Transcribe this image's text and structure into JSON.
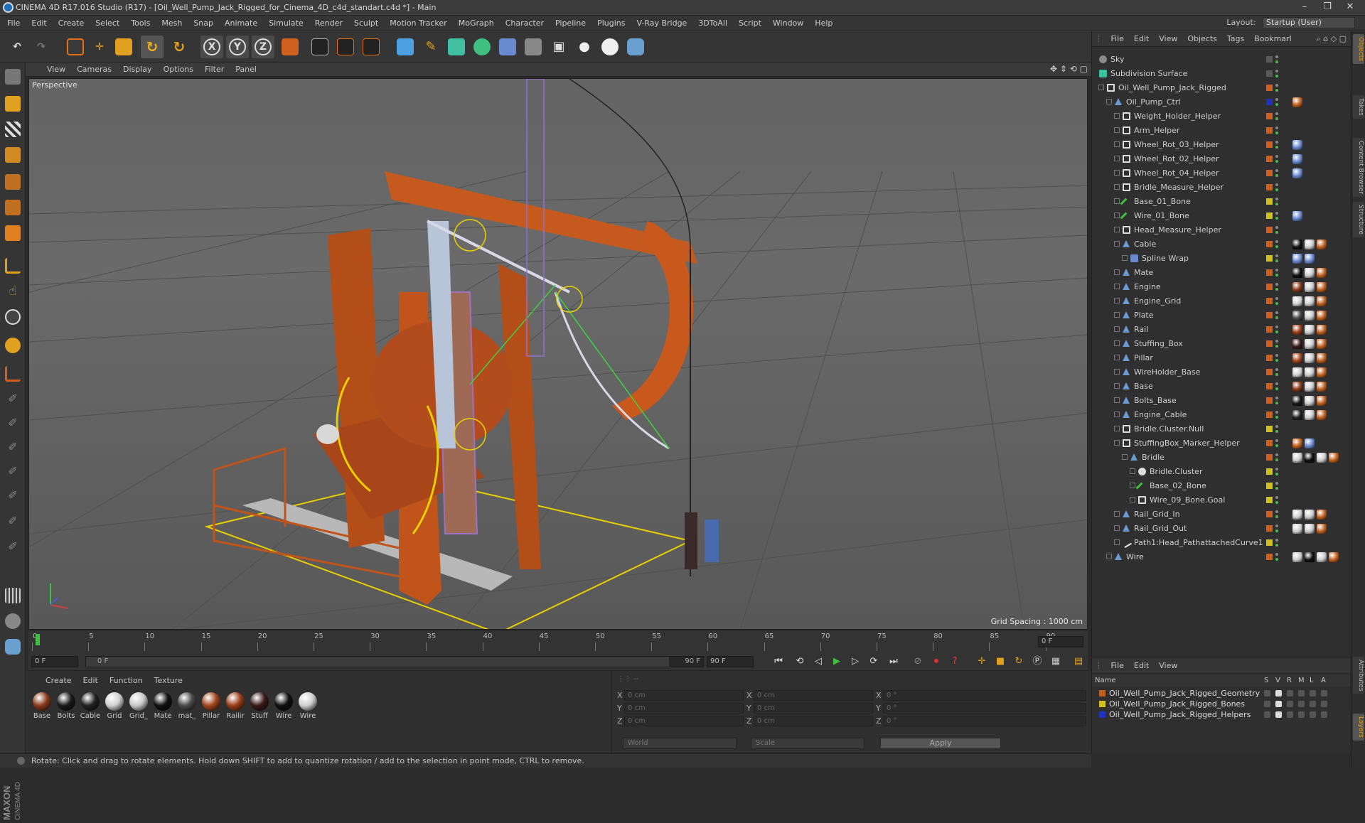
{
  "window": {
    "title": "CINEMA 4D R17.016 Studio (R17) - [Oil_Well_Pump_Jack_Rigged_for_Cinema_4D_c4d_standart.c4d *] - Main",
    "minimize": "–",
    "restore": "❐",
    "close": "✕"
  },
  "menu": [
    "File",
    "Edit",
    "Create",
    "Select",
    "Tools",
    "Mesh",
    "Snap",
    "Animate",
    "Simulate",
    "Render",
    "Sculpt",
    "Motion Tracker",
    "MoGraph",
    "Character",
    "Pipeline",
    "Plugins",
    "V-Ray Bridge",
    "3DToAll",
    "Script",
    "Window",
    "Help"
  ],
  "layout": {
    "label": "Layout:",
    "value": "Startup (User)"
  },
  "toolbar_axes": [
    "X",
    "Y",
    "Z"
  ],
  "viewport": {
    "menu": [
      "View",
      "Cameras",
      "Display",
      "Options",
      "Filter",
      "Panel"
    ],
    "camera_label": "Perspective",
    "grid_spacing": "Grid Spacing : 1000 cm"
  },
  "timeline": {
    "ticks": [
      "0",
      "5",
      "10",
      "15",
      "20",
      "25",
      "30",
      "35",
      "40",
      "45",
      "50",
      "55",
      "60",
      "65",
      "70",
      "75",
      "80",
      "85",
      "90"
    ],
    "end_frame_field": "0 F"
  },
  "playback": {
    "current_frame": "0 F",
    "min_frame": "0 F",
    "max_frame": "90 F",
    "end_frame": "90 F"
  },
  "materials": {
    "menu": [
      "Create",
      "Edit",
      "Function",
      "Texture"
    ],
    "items": [
      {
        "label": "Base",
        "color": "#8a3a1a"
      },
      {
        "label": "Bolts",
        "color": "#1a1a1a"
      },
      {
        "label": "Cable",
        "color": "#222222"
      },
      {
        "label": "Grid",
        "color": "#d0d0d0"
      },
      {
        "label": "Grid_",
        "color": "#c8c8c8"
      },
      {
        "label": "Mate",
        "color": "#101010"
      },
      {
        "label": "mat_",
        "color": "#4a4a4a"
      },
      {
        "label": "Pillar",
        "color": "#a2461e"
      },
      {
        "label": "Railir",
        "color": "#9a3e18"
      },
      {
        "label": "Stuff",
        "color": "#3a1a1a"
      },
      {
        "label": "Wire",
        "color": "#111111"
      },
      {
        "label": "Wire",
        "color": "#cfcfcf"
      }
    ]
  },
  "coords": {
    "rows": [
      {
        "a1": "X",
        "v1": "0 cm",
        "a2": "X",
        "v2": "0 cm",
        "a3": "X",
        "v3": "0 °"
      },
      {
        "a1": "Y",
        "v1": "0 cm",
        "a2": "Y",
        "v2": "0 cm",
        "a3": "Y",
        "v3": "0 °"
      },
      {
        "a1": "Z",
        "v1": "0 cm",
        "a2": "Z",
        "v2": "0 cm",
        "a3": "Z",
        "v3": "0 °"
      }
    ],
    "space": "World",
    "mode": "Scale",
    "apply": "Apply"
  },
  "status": "Rotate: Click and drag to rotate elements. Hold down SHIFT to add to quantize rotation / add to the selection in point mode, CTRL to remove.",
  "objects": {
    "menu": [
      "File",
      "Edit",
      "View",
      "Objects",
      "Tags",
      "Bookmarl"
    ],
    "rows": [
      {
        "name": "Sky",
        "depth": 0,
        "icon": "sky",
        "color": "#5a5a5a",
        "tags": []
      },
      {
        "name": "Subdivision Surface",
        "depth": 0,
        "icon": "subdiv",
        "color": "#5a5a5a",
        "tags": []
      },
      {
        "name": "Oil_Well_Pump_Jack_Rigged",
        "depth": 1,
        "icon": "null",
        "color": "#d06020",
        "tags": []
      },
      {
        "name": "Oil_Pump_Ctrl",
        "depth": 2,
        "icon": "poly",
        "color": "#2030c0",
        "tags": [
          "#c06020"
        ]
      },
      {
        "name": "Weight_Holder_Helper",
        "depth": 3,
        "icon": "null",
        "color": "#d06020",
        "tags": []
      },
      {
        "name": "Arm_Helper",
        "depth": 3,
        "icon": "null",
        "color": "#d06020",
        "tags": []
      },
      {
        "name": "Wheel_Rot_03_Helper",
        "depth": 3,
        "icon": "null",
        "color": "#d06020",
        "tags": [
          "#6a8ad0"
        ]
      },
      {
        "name": "Wheel_Rot_02_Helper",
        "depth": 3,
        "icon": "null",
        "color": "#d06020",
        "tags": [
          "#6a8ad0"
        ]
      },
      {
        "name": "Wheel_Rot_04_Helper",
        "depth": 3,
        "icon": "null",
        "color": "#d06020",
        "tags": [
          "#6a8ad0"
        ]
      },
      {
        "name": "Bridle_Measure_Helper",
        "depth": 3,
        "icon": "null",
        "color": "#d06020",
        "tags": []
      },
      {
        "name": "Base_01_Bone",
        "depth": 3,
        "icon": "bone",
        "color": "#d0c020",
        "tags": []
      },
      {
        "name": "Wire_01_Bone",
        "depth": 3,
        "icon": "bone",
        "color": "#d0c020",
        "tags": [
          "#6a8ad0"
        ]
      },
      {
        "name": "Head_Measure_Helper",
        "depth": 3,
        "icon": "null",
        "color": "#d06020",
        "tags": []
      },
      {
        "name": "Cable",
        "depth": 3,
        "icon": "poly",
        "color": "#d06020",
        "tags": [
          "#111111",
          "#cccccc",
          "#c06020"
        ]
      },
      {
        "name": "Spline Wrap",
        "depth": 4,
        "icon": "deform",
        "color": "#d0c020",
        "tags": [
          "#6a8ad0",
          "#6a8ad0"
        ]
      },
      {
        "name": "Mate",
        "depth": 3,
        "icon": "poly",
        "color": "#d06020",
        "tags": [
          "#111111",
          "#cccccc",
          "#c06020"
        ]
      },
      {
        "name": "Engine",
        "depth": 3,
        "icon": "poly",
        "color": "#d06020",
        "tags": [
          "#8a3a1a",
          "#cccccc",
          "#c06020"
        ]
      },
      {
        "name": "Engine_Grid",
        "depth": 3,
        "icon": "poly",
        "color": "#d06020",
        "tags": [
          "#d0d0d0",
          "#cccccc",
          "#c06020"
        ]
      },
      {
        "name": "Plate",
        "depth": 3,
        "icon": "poly",
        "color": "#d06020",
        "tags": [
          "#4a4a4a",
          "#cccccc",
          "#c06020"
        ]
      },
      {
        "name": "Rail",
        "depth": 3,
        "icon": "poly",
        "color": "#d06020",
        "tags": [
          "#9a3e18",
          "#cccccc",
          "#c06020"
        ]
      },
      {
        "name": "Stuffing_Box",
        "depth": 3,
        "icon": "poly",
        "color": "#d06020",
        "tags": [
          "#3a1a1a",
          "#cccccc",
          "#c06020"
        ]
      },
      {
        "name": "Pillar",
        "depth": 3,
        "icon": "poly",
        "color": "#d06020",
        "tags": [
          "#a2461e",
          "#cccccc",
          "#c06020"
        ]
      },
      {
        "name": "WireHolder_Base",
        "depth": 3,
        "icon": "poly",
        "color": "#d06020",
        "tags": [
          "#cfcfcf",
          "#cccccc",
          "#c06020"
        ]
      },
      {
        "name": "Base",
        "depth": 3,
        "icon": "poly",
        "color": "#d06020",
        "tags": [
          "#8a3a1a",
          "#cccccc",
          "#c06020"
        ]
      },
      {
        "name": "Bolts_Base",
        "depth": 3,
        "icon": "poly",
        "color": "#d06020",
        "tags": [
          "#1a1a1a",
          "#cccccc",
          "#c06020"
        ]
      },
      {
        "name": "Engine_Cable",
        "depth": 3,
        "icon": "poly",
        "color": "#d06020",
        "tags": [
          "#222222",
          "#cccccc",
          "#c06020"
        ]
      },
      {
        "name": "Bridle.Cluster.Null",
        "depth": 3,
        "icon": "null",
        "color": "#d0c020",
        "tags": []
      },
      {
        "name": "StuffingBox_Marker_Helper",
        "depth": 3,
        "icon": "null",
        "color": "#d06020",
        "tags": [
          "#c06020",
          "#6a8ad0"
        ]
      },
      {
        "name": "Bridle",
        "depth": 4,
        "icon": "poly",
        "color": "#d06020",
        "tags": [
          "#cccccc",
          "#111111",
          "#cccccc",
          "#c06020"
        ]
      },
      {
        "name": "Bridle.Cluster",
        "depth": 5,
        "icon": "cluster",
        "color": "#d0c020",
        "tags": []
      },
      {
        "name": "Base_02_Bone",
        "depth": 5,
        "icon": "bone",
        "color": "#d0c020",
        "tags": []
      },
      {
        "name": "Wire_09_Bone.Goal",
        "depth": 5,
        "icon": "null",
        "color": "#d0c020",
        "tags": []
      },
      {
        "name": "Rail_Grid_In",
        "depth": 3,
        "icon": "poly",
        "color": "#d06020",
        "tags": [
          "#d0d0d0",
          "#cccccc",
          "#c06020"
        ]
      },
      {
        "name": "Rail_Grid_Out",
        "depth": 3,
        "icon": "poly",
        "color": "#d06020",
        "tags": [
          "#d0d0d0",
          "#cccccc",
          "#c06020"
        ]
      },
      {
        "name": "Path1:Head_PathattachedCurve1",
        "depth": 3,
        "icon": "spline",
        "color": "#d0c020",
        "tags": []
      },
      {
        "name": "Wire",
        "depth": 2,
        "icon": "poly",
        "color": "#d06020",
        "tags": [
          "#cccccc",
          "#111111",
          "#cccccc",
          "#c06020"
        ]
      }
    ]
  },
  "layers": {
    "menu": [
      "File",
      "Edit",
      "View"
    ],
    "header": {
      "name": "Name",
      "cols": [
        "S",
        "V",
        "R",
        "M",
        "L",
        "A"
      ]
    },
    "rows": [
      {
        "name": "Oil_Well_Pump_Jack_Rigged_Geometry",
        "color": "#c06020"
      },
      {
        "name": "Oil_Well_Pump_Jack_Rigged_Bones",
        "color": "#d0c020"
      },
      {
        "name": "Oil_Well_Pump_Jack_Rigged_Helpers",
        "color": "#2030c0"
      }
    ]
  },
  "side_tabs": [
    "Objects",
    "Takes",
    "Content Browser",
    "Structure",
    "Attributes",
    "Layers"
  ],
  "colors": {
    "accent": "#e0701a",
    "selection_yellow": "#e8d000",
    "play_green": "#40c040"
  }
}
